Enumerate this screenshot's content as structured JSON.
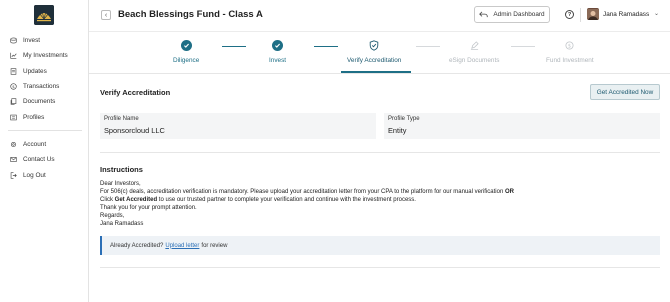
{
  "sidebar": {
    "items": [
      {
        "label": "Invest",
        "icon": "coins-icon"
      },
      {
        "label": "My Investments",
        "icon": "chart-icon"
      },
      {
        "label": "Updates",
        "icon": "document-icon"
      },
      {
        "label": "Transactions",
        "icon": "dollar-circle-icon"
      },
      {
        "label": "Documents",
        "icon": "documents-icon"
      },
      {
        "label": "Profiles",
        "icon": "profiles-icon"
      },
      {
        "label": "Account",
        "icon": "gear-icon"
      },
      {
        "label": "Contact Us",
        "icon": "mail-icon"
      },
      {
        "label": "Log Out",
        "icon": "logout-icon"
      }
    ]
  },
  "header": {
    "title": "Beach Blessings Fund - Class A",
    "admin_button": "Admin Dashboard",
    "help_label": "?",
    "user_name": "Jana Ramadass"
  },
  "stepper": {
    "steps": [
      {
        "label": "Diligence",
        "state": "done"
      },
      {
        "label": "Invest",
        "state": "done"
      },
      {
        "label": "Verify Accreditation",
        "state": "active"
      },
      {
        "label": "eSign Documents",
        "state": "pending"
      },
      {
        "label": "Fund Investment",
        "state": "pending"
      }
    ]
  },
  "verify": {
    "title": "Verify Accreditation",
    "get_accredited_button": "Get Accredited Now",
    "profile_name_label": "Profile Name",
    "profile_name_value": "Sponsorcloud LLC",
    "profile_type_label": "Profile Type",
    "profile_type_value": "Entity"
  },
  "instructions": {
    "title": "Instructions",
    "greeting": "Dear Investors,",
    "line1_a": "For 506(c) deals, accreditation verification is mandatory. Please upload your accreditation letter from your CPA to the platform for our manual verification ",
    "line1_b": "OR",
    "line2_a": "Click ",
    "line2_b": "Get Accredited",
    "line2_c": " to use our trusted partner to complete your verification and continue with the investment process.",
    "line3": "Thank you for your prompt attention.",
    "regards": "Regards,",
    "signature": "Jana Ramadass"
  },
  "callout": {
    "prefix": "Already Accredited?",
    "link": "Upload letter",
    "suffix": "for review"
  },
  "colors": {
    "accent": "#1e6f86",
    "link": "#2b6fb6",
    "pending": "#b0b6bb"
  }
}
